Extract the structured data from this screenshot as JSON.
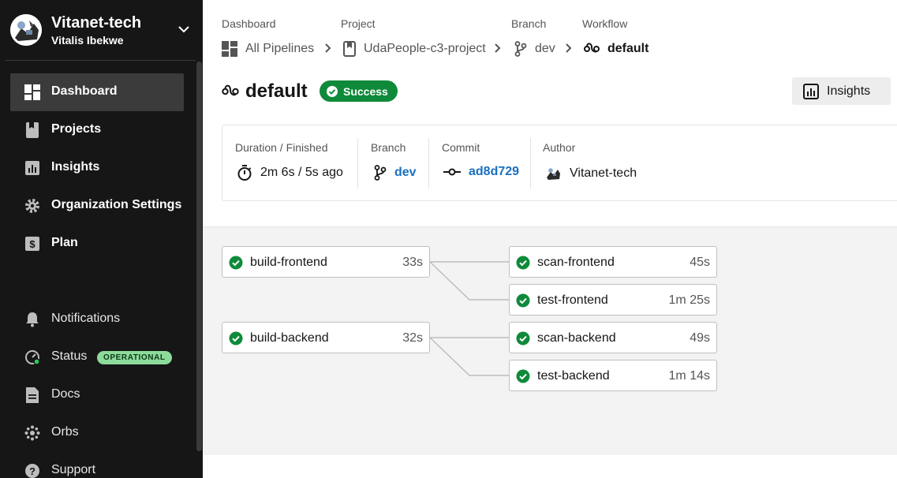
{
  "sidebar": {
    "org_name": "Vitanet-tech",
    "user_name": "Vitalis Ibekwe",
    "nav": [
      {
        "label": "Dashboard",
        "icon": "dashboard-icon",
        "active": true
      },
      {
        "label": "Projects",
        "icon": "projects-icon"
      },
      {
        "label": "Insights",
        "icon": "insights-icon"
      },
      {
        "label": "Organization Settings",
        "icon": "gear-icon"
      },
      {
        "label": "Plan",
        "icon": "dollar-icon"
      }
    ],
    "secondary": [
      {
        "label": "Notifications",
        "icon": "bell-icon"
      },
      {
        "label": "Status",
        "icon": "status-icon",
        "badge": "OPERATIONAL"
      },
      {
        "label": "Docs",
        "icon": "document-icon"
      },
      {
        "label": "Orbs",
        "icon": "orbs-icon"
      },
      {
        "label": "Support",
        "icon": "help-icon"
      }
    ]
  },
  "breadcrumbs": [
    {
      "label": "Dashboard",
      "value": "All Pipelines",
      "icon": "dashboard-icon"
    },
    {
      "label": "Project",
      "value": "UdaPeople-c3-project",
      "icon": "bookmark-icon"
    },
    {
      "label": "Branch",
      "value": "dev",
      "icon": "branch-icon"
    },
    {
      "label": "Workflow",
      "value": "default",
      "icon": "workflow-icon"
    }
  ],
  "workflow": {
    "title": "default",
    "status": "Success",
    "insights_label": "Insights"
  },
  "info": {
    "duration_label": "Duration / Finished",
    "duration_value": "2m 6s / 5s ago",
    "branch_label": "Branch",
    "branch_value": "dev",
    "commit_label": "Commit",
    "commit_value": "ad8d729",
    "author_label": "Author",
    "author_value": "Vitanet-tech"
  },
  "jobs": [
    {
      "name": "build-frontend",
      "time": "33s",
      "status": "success"
    },
    {
      "name": "scan-frontend",
      "time": "45s",
      "status": "success"
    },
    {
      "name": "test-frontend",
      "time": "1m 25s",
      "status": "success"
    },
    {
      "name": "build-backend",
      "time": "32s",
      "status": "success"
    },
    {
      "name": "scan-backend",
      "time": "49s",
      "status": "success"
    },
    {
      "name": "test-backend",
      "time": "1m 14s",
      "status": "success"
    }
  ],
  "colors": {
    "sidebar_bg": "#161616",
    "success_green": "#0f8a3a",
    "operational_badge": "#8ddb9a",
    "link_blue": "#1a6fbf"
  }
}
